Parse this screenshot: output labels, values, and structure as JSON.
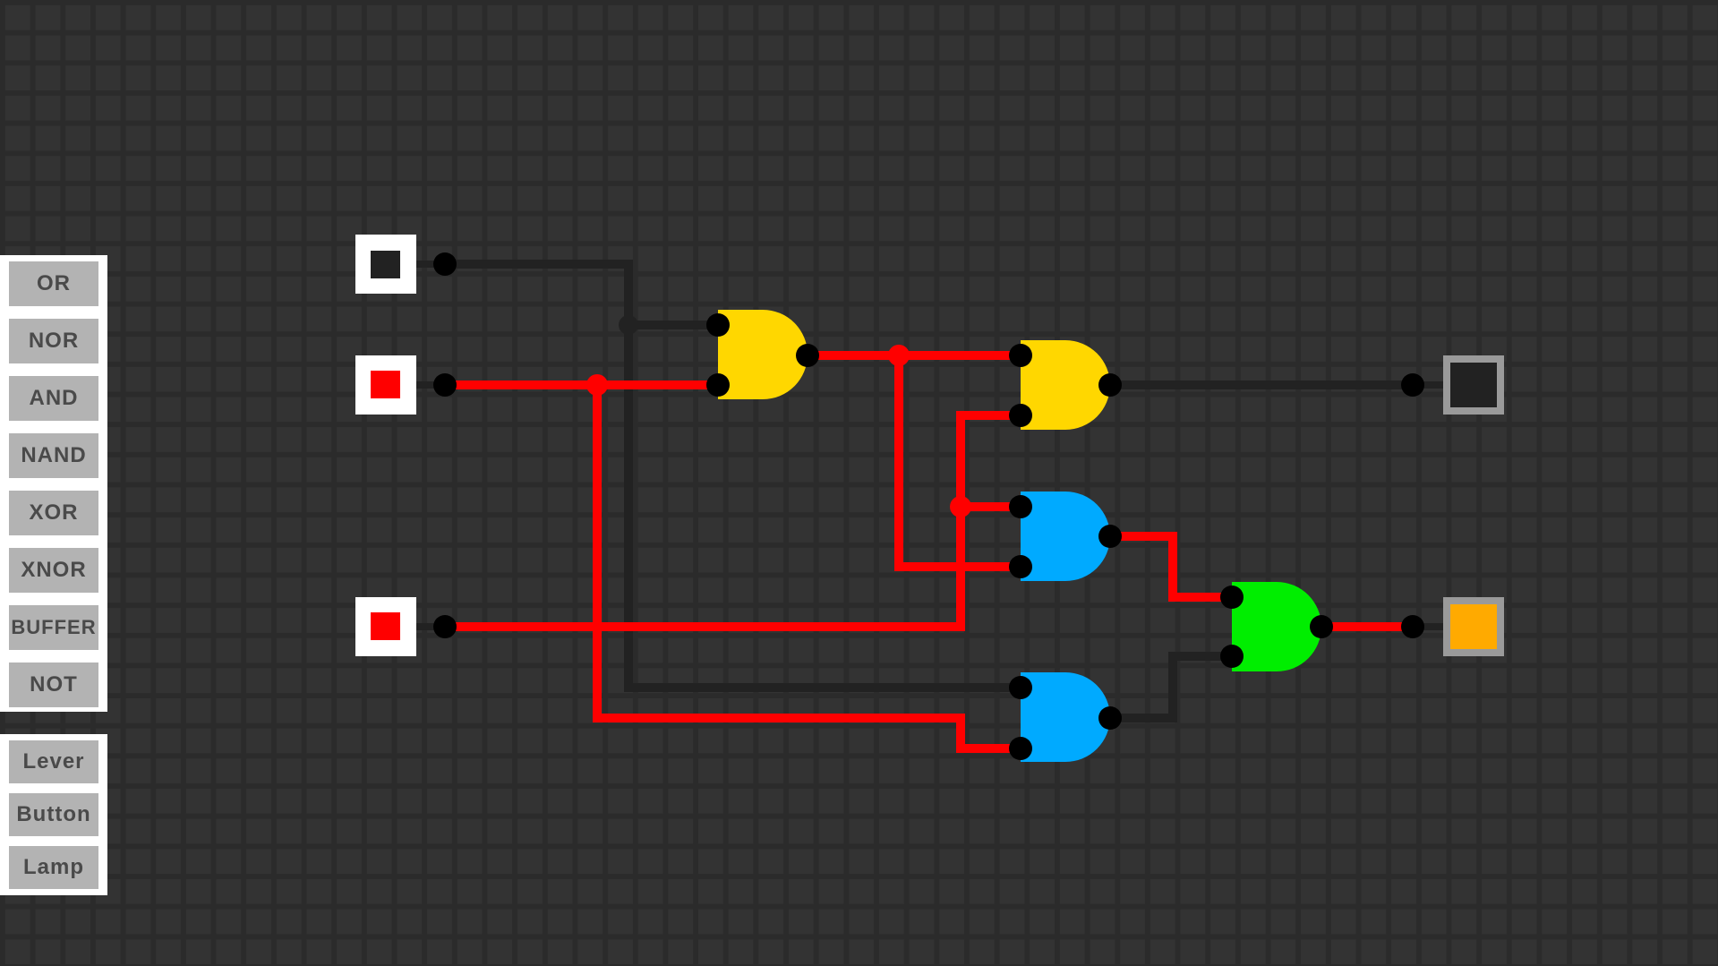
{
  "palette": {
    "gates": [
      {
        "label": "OR"
      },
      {
        "label": "NOR"
      },
      {
        "label": "AND"
      },
      {
        "label": "NAND"
      },
      {
        "label": "XOR"
      },
      {
        "label": "XNOR"
      },
      {
        "label": "BUFFER"
      },
      {
        "label": "NOT"
      }
    ],
    "io": [
      {
        "label": "Lever"
      },
      {
        "label": "Button"
      },
      {
        "label": "Lamp"
      }
    ]
  },
  "colors": {
    "background": "#333333",
    "grid": "#2b2b2b",
    "wire_on": "#ff0000",
    "wire_off": "#222222",
    "gate_and": "#ffd700",
    "gate_nand": "#00aaff",
    "gate_xor": "#00ee00",
    "lamp_on": "#ffaa00",
    "lamp_off": "#222222",
    "pin": "#000000"
  },
  "circuit": {
    "levers": [
      {
        "id": "lever-1",
        "state": "off"
      },
      {
        "id": "lever-2",
        "state": "on"
      },
      {
        "id": "lever-3",
        "state": "on"
      }
    ],
    "gates": [
      {
        "id": "and-gate-1",
        "type": "AND",
        "color": "#ffd700",
        "output": "on"
      },
      {
        "id": "and-gate-2",
        "type": "AND",
        "color": "#ffd700",
        "output": "off"
      },
      {
        "id": "nand-gate-1",
        "type": "NAND",
        "color": "#00aaff",
        "output": "on"
      },
      {
        "id": "nand-gate-2",
        "type": "NAND",
        "color": "#00aaff",
        "output": "off"
      },
      {
        "id": "xor-gate-1",
        "type": "XOR",
        "color": "#00ee00",
        "output": "on"
      }
    ],
    "lamps": [
      {
        "id": "lamp-1",
        "state": "off"
      },
      {
        "id": "lamp-2",
        "state": "on"
      }
    ]
  }
}
